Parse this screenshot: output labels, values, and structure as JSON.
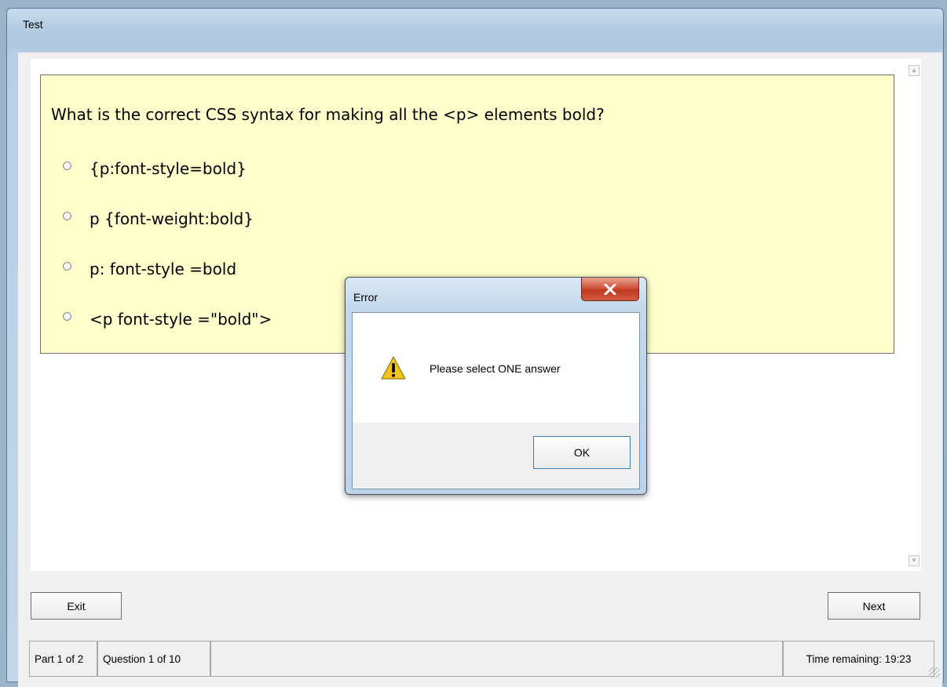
{
  "window": {
    "title": "Test"
  },
  "question": {
    "text": "What is the correct CSS syntax for making all the <p> elements bold?",
    "options": [
      {
        "label": "{p:font-style=bold}"
      },
      {
        "label": "p {font-weight:bold}"
      },
      {
        "label": "p: font-style =bold"
      },
      {
        "label": "<p font-style =\"bold\">"
      }
    ]
  },
  "buttons": {
    "exit": "Exit",
    "next": "Next"
  },
  "status": {
    "part": "Part 1 of 2",
    "question": "Question 1 of 10",
    "time": "Time remaining: 19:23"
  },
  "dialog": {
    "title": "Error",
    "message": "Please select ONE answer",
    "ok": "OK",
    "icon": "warning-icon"
  },
  "colors": {
    "question_bg": "#ffffcc",
    "close_button": "#c74530"
  }
}
